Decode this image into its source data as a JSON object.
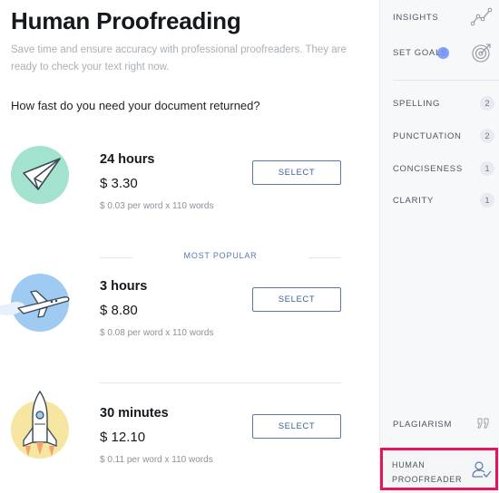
{
  "page": {
    "title": "Human Proofreading",
    "subtitle": "Save time and ensure accuracy with professional proofreaders. They are ready to check your text right now.",
    "question": "How fast do you need your document returned?"
  },
  "options": [
    {
      "time": "24 hours",
      "price": "$ 3.30",
      "rate": "$ 0.03 per word x 110 words",
      "button": "SELECT",
      "icon": "paper-plane-icon",
      "color": "#a2e2cf"
    },
    {
      "time": "3 hours",
      "price": "$ 8.80",
      "rate": "$ 0.08 per word x 110 words",
      "button": "SELECT",
      "icon": "airplane-icon",
      "color": "#9fcaf2"
    },
    {
      "time": "30 minutes",
      "price": "$ 12.10",
      "rate": "$ 0.11 per word x 110 words",
      "button": "SELECT",
      "icon": "rocket-icon",
      "color": "#f6e6a2"
    }
  ],
  "popular_label": "MOST POPULAR",
  "sidebar": {
    "insights": {
      "label": "INSIGHTS",
      "icon": "trend-chart-icon"
    },
    "set_goals": {
      "label": "SET GOALS",
      "icon": "target-icon"
    },
    "checks": [
      {
        "label": "SPELLING",
        "count": "2"
      },
      {
        "label": "PUNCTUATION",
        "count": "2"
      },
      {
        "label": "CONCISENESS",
        "count": "1"
      },
      {
        "label": "CLARITY",
        "count": "1"
      }
    ],
    "plagiarism": {
      "label": "PLAGIARISM",
      "icon": "quote-icon"
    },
    "human_proofreader": {
      "line1": "HUMAN",
      "line2": "PROOFREADER",
      "icon": "person-check-icon"
    }
  },
  "colors": {
    "accent": "#5a78ad",
    "highlight": "#e8145a",
    "goal_dot": "#6f93f4"
  }
}
